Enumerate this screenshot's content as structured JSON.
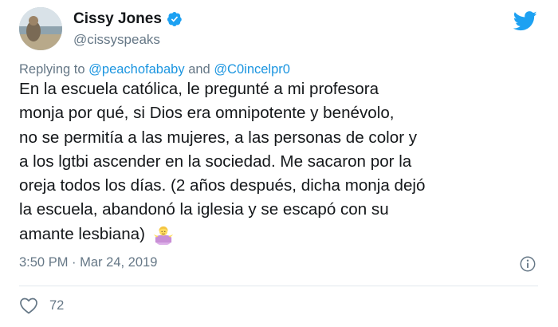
{
  "author": {
    "display_name": "Cissy Jones",
    "handle": "@cissyspeaks",
    "verified": true
  },
  "reply": {
    "prefix": "Replying to",
    "mention_1": "@peachofababy",
    "conjunction": "and",
    "mention_2": "@C0incelpr0"
  },
  "tweet": {
    "text": "En la escuela católica, le pregunté a mi profesora\nmonja por qué, si Dios era omnipotente y benévolo,\nno se permitía a las mujeres, a las personas de color y\na los lgtbi ascender en la sociedad. Me sacaron por la\noreja todos los días. (2 años después, dicha monja dejó\nla escuela, abandonó la iglesia y se escapó con su\namante lesbiana)",
    "emoji": "person-shrugging"
  },
  "meta": {
    "time": "3:50 PM",
    "separator": "·",
    "date": "Mar 24, 2019"
  },
  "stats": {
    "likes": "72"
  },
  "colors": {
    "accent": "#1da1f2",
    "link": "#1b95e0",
    "muted": "#657786",
    "like": "#e0245e"
  }
}
